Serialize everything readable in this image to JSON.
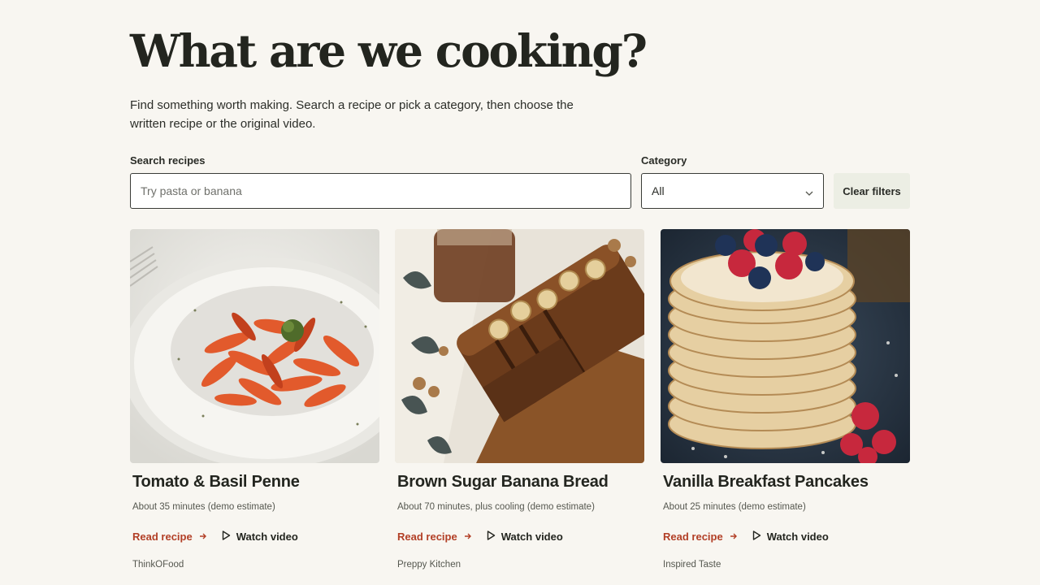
{
  "header": {
    "title": "What are we cooking?",
    "intro": "Find something worth making. Search a recipe or pick a category, then choose the written recipe or the original video."
  },
  "filters": {
    "search_label": "Search recipes",
    "search_placeholder": "Try pasta or banana",
    "search_value": "",
    "category_label": "Category",
    "category_selected": "All",
    "clear_label": "Clear filters"
  },
  "recipes": [
    {
      "title": "Tomato & Basil Penne",
      "meta": "About 35 minutes (demo estimate)",
      "read_label": "Read recipe",
      "watch_label": "Watch video",
      "source": "ThinkOFood"
    },
    {
      "title": "Brown Sugar Banana Bread",
      "meta": "About 70 minutes, plus cooling (demo estimate)",
      "read_label": "Read recipe",
      "watch_label": "Watch video",
      "source": "Preppy Kitchen"
    },
    {
      "title": "Vanilla Breakfast Pancakes",
      "meta": "About 25 minutes (demo estimate)",
      "read_label": "Read recipe",
      "watch_label": "Watch video",
      "source": "Inspired Taste"
    }
  ],
  "icons": {
    "read_arrow": "arrow-right-icon",
    "watch": "play-icon",
    "select": "chevron-down-icon"
  },
  "colors": {
    "background": "#f8f6f1",
    "accent": "#b23f26",
    "text": "#23251f",
    "button_bg": "#eceee4"
  }
}
